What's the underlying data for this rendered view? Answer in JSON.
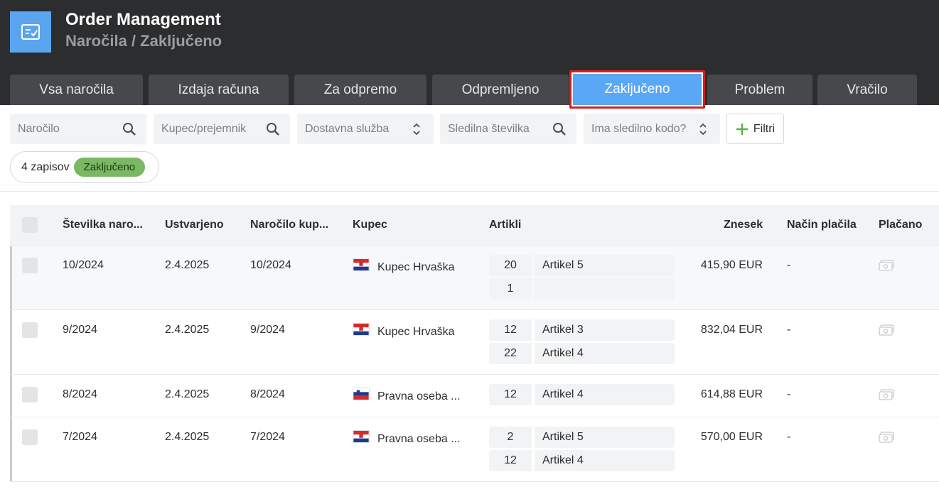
{
  "app": {
    "title": "Order Management",
    "breadcrumb": "Naročila / Zaključeno",
    "accent": "#5aa8f5",
    "highlight": "#d61f1f"
  },
  "tabs": [
    {
      "label": "Vsa naročila"
    },
    {
      "label": "Izdaja računa"
    },
    {
      "label": "Za odpremo"
    },
    {
      "label": "Odpremljeno"
    },
    {
      "label": "Zaključeno",
      "active": true
    },
    {
      "label": "Problem"
    },
    {
      "label": "Vračilo"
    }
  ],
  "filters": {
    "order": {
      "placeholder": "Naročilo",
      "icon": "search-icon"
    },
    "customer": {
      "placeholder": "Kupec/prejemnik",
      "icon": "search-icon"
    },
    "shipping": {
      "placeholder": "Dostavna služba",
      "icon": "updown-icon"
    },
    "tracking": {
      "placeholder": "Sledilna številka",
      "icon": "search-icon"
    },
    "has_tracking": {
      "placeholder": "Ima sledilno kodo?",
      "icon": "updown-icon"
    },
    "filters_button": "Filtri"
  },
  "summary": {
    "count": "4 zapisov",
    "status": "Zaključeno",
    "status_color": "#7ab863"
  },
  "table": {
    "headers": {
      "number": "Številka naro...",
      "created": "Ustvarjeno",
      "customer_order": "Naročilo kup...",
      "customer": "Kupec",
      "items": "Artikli",
      "amount": "Znesek",
      "payment_method": "Način plačila",
      "paid": "Plačano"
    },
    "rows": [
      {
        "number": "10/2024",
        "created": "2.4.2025",
        "customer_order": "10/2024",
        "flag": "croatia-flag-icon",
        "customer": "Kupec Hrvaška",
        "items": [
          {
            "qty": "20",
            "name": "Artikel 5"
          },
          {
            "qty": "1",
            "name": ""
          }
        ],
        "amount": "415,90 EUR",
        "payment_method": "-",
        "paid_icon": "money-icon"
      },
      {
        "number": "9/2024",
        "created": "2.4.2025",
        "customer_order": "9/2024",
        "flag": "croatia-flag-icon",
        "customer": "Kupec Hrvaška",
        "items": [
          {
            "qty": "12",
            "name": "Artikel 3"
          },
          {
            "qty": "22",
            "name": "Artikel 4"
          }
        ],
        "amount": "832,04 EUR",
        "payment_method": "-",
        "paid_icon": "money-icon"
      },
      {
        "number": "8/2024",
        "created": "2.4.2025",
        "customer_order": "8/2024",
        "flag": "slovenia-flag-icon",
        "customer": "Pravna oseba ...",
        "items": [
          {
            "qty": "12",
            "name": "Artikel 4"
          }
        ],
        "amount": "614,88 EUR",
        "payment_method": "-",
        "paid_icon": "money-icon"
      },
      {
        "number": "7/2024",
        "created": "2.4.2025",
        "customer_order": "7/2024",
        "flag": "croatia-flag-icon",
        "customer": "Pravna oseba ...",
        "items": [
          {
            "qty": "2",
            "name": "Artikel 5"
          },
          {
            "qty": "12",
            "name": "Artikel 4"
          }
        ],
        "amount": "570,00 EUR",
        "payment_method": "-",
        "paid_icon": "money-icon"
      }
    ]
  }
}
